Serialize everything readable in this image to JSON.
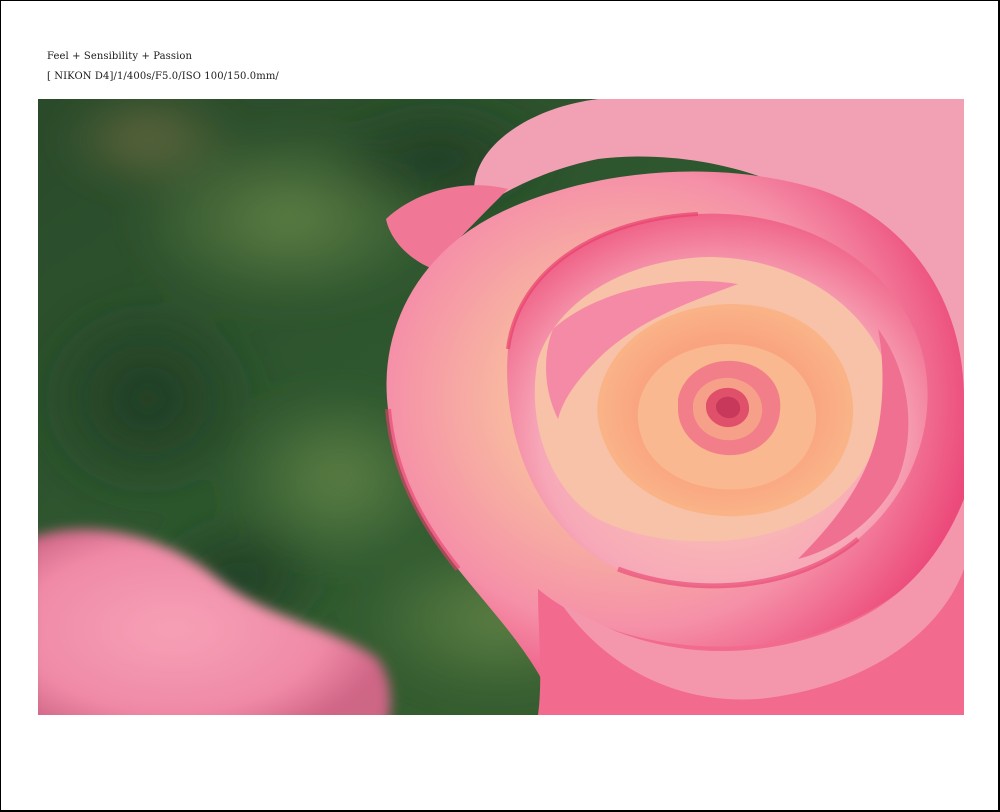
{
  "caption": {
    "title": "Feel + Sensibility + Passion",
    "exif": "[ NIKON D4]/1/400s/F5.0/ISO 100/150.0mm/"
  },
  "photo": {
    "subject": "rose-photo",
    "colors": {
      "background_green": "#2f5a30",
      "petal_pink": "#f0507a",
      "petal_light": "#f7b0bf",
      "center_peach": "#f8a070"
    }
  }
}
